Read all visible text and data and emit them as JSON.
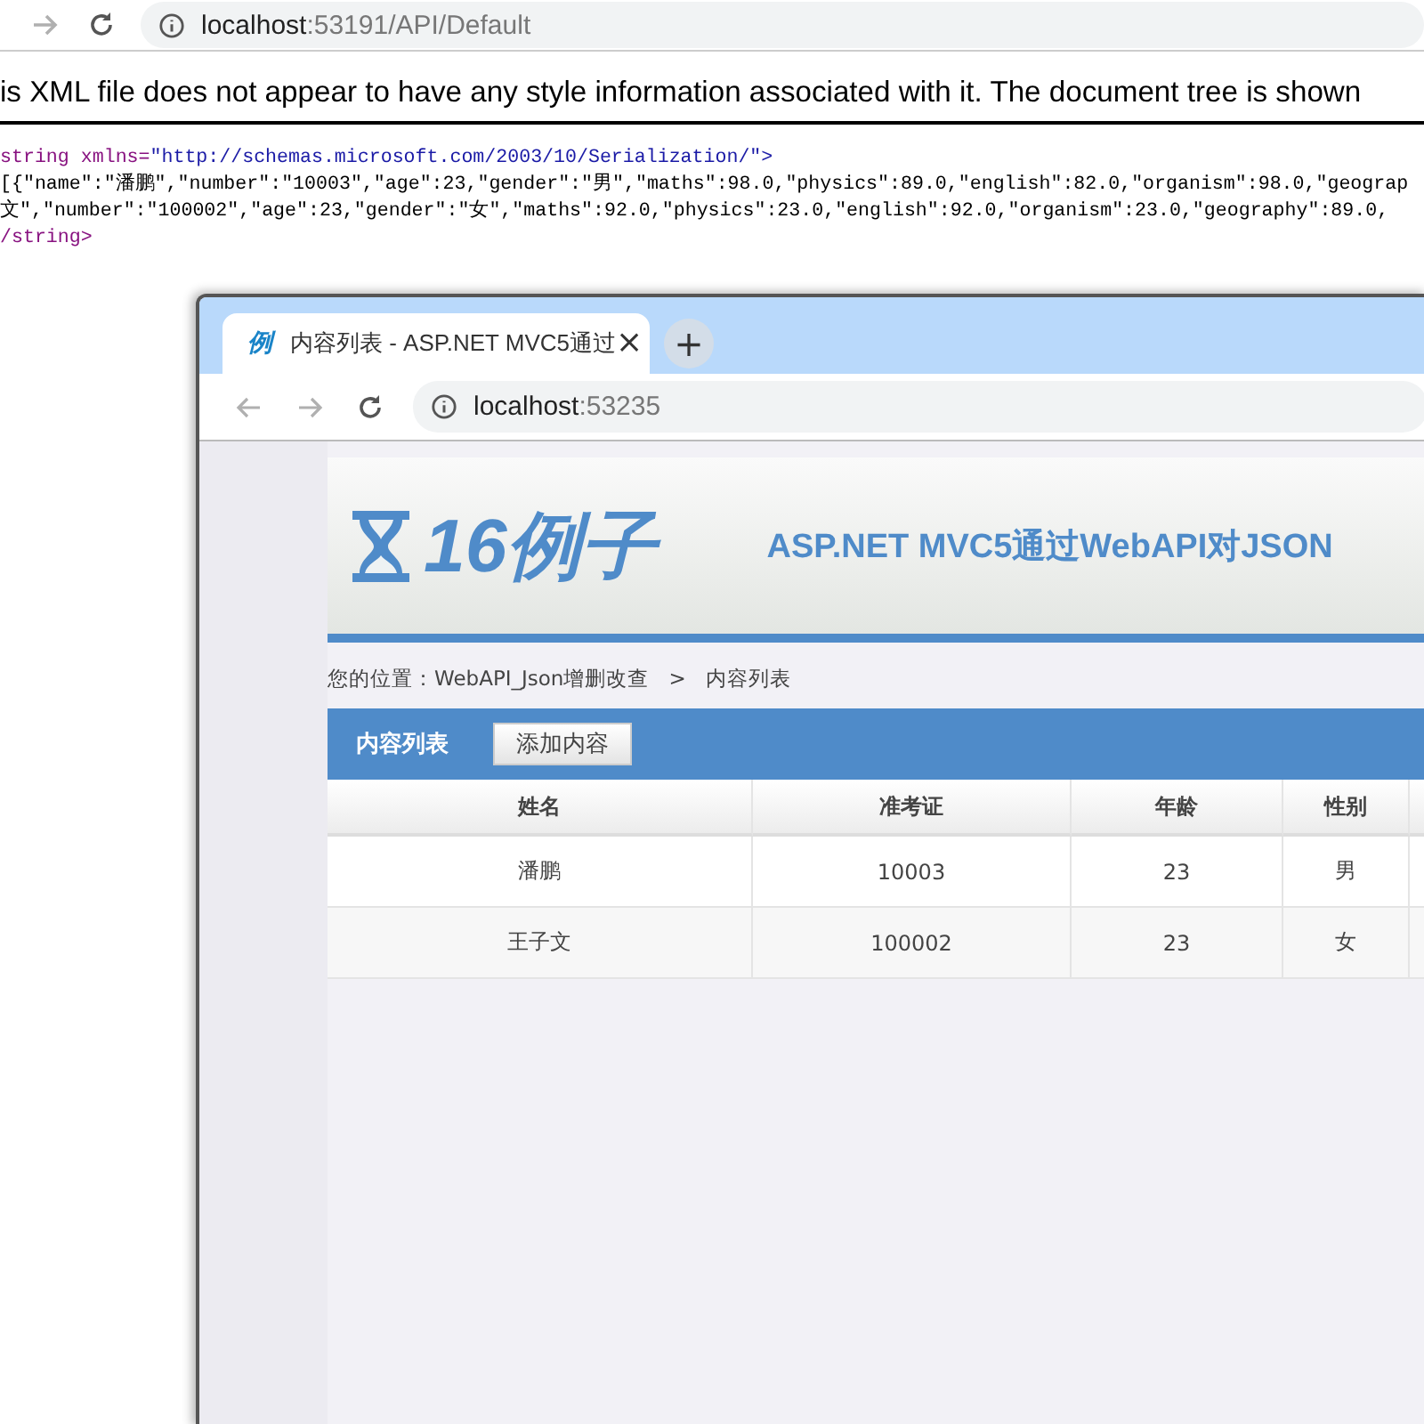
{
  "browser": {
    "address_host": "localhost",
    "address_rest": ":53191/API/Default"
  },
  "xml_notice": "is XML file does not appear to have any style information associated with it. The document tree is shown",
  "xml_lines": [
    {
      "kind": "tag",
      "text": "string",
      "attr": "xmlns=",
      "value": "\"http://schemas.microsoft.com/2003/10/Serialization/\">"
    },
    {
      "kind": "text",
      "text": " [{\"name\":\"潘鹏\",\"number\":\"10003\",\"age\":23,\"gender\":\"男\",\"maths\":98.0,\"physics\":89.0,\"english\":82.0,\"organism\":98.0,\"geograp"
    },
    {
      "kind": "text",
      "text": " 文\",\"number\":\"100002\",\"age\":23,\"gender\":\"女\",\"maths\":92.0,\"physics\":23.0,\"english\":92.0,\"organism\":23.0,\"geography\":89.0,"
    },
    {
      "kind": "tag",
      "text": "/string>"
    }
  ],
  "window": {
    "tab": {
      "icon_text": "例",
      "title": "内容列表 - ASP.NET MVC5通过",
      "close": "×"
    },
    "new_tab": "+",
    "address_host": "localhost",
    "address_rest": ":53235",
    "site": {
      "logo_text": "16例子",
      "title": "ASP.NET MVC5通过WebAPI对JSON",
      "breadcrumb": [
        "您的位置：WebAPI_Json增删改查",
        ">",
        "内容列表"
      ],
      "panel_title": "内容列表",
      "add_button": "添加内容",
      "table": {
        "columns": [
          "姓名",
          "准考证",
          "年龄",
          "性别"
        ],
        "rows": [
          [
            "潘鹏",
            "10003",
            "23",
            "男"
          ],
          [
            "王子文",
            "100002",
            "23",
            "女"
          ]
        ]
      }
    }
  }
}
